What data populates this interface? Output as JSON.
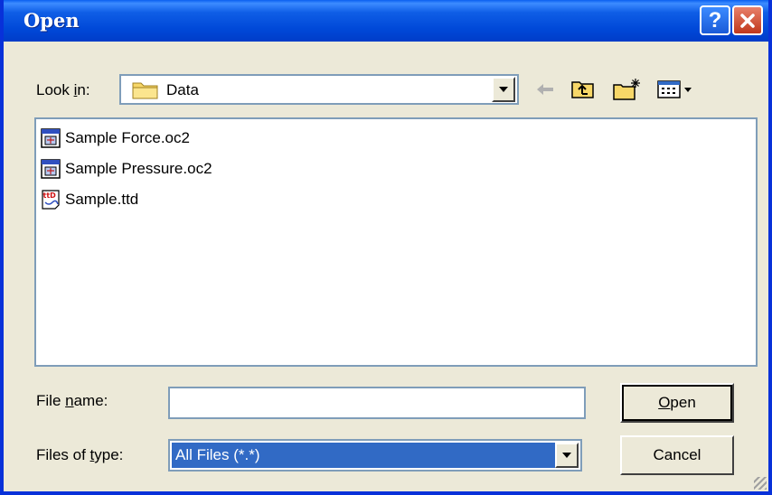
{
  "window": {
    "title": "Open"
  },
  "toolbar": {
    "look_in_label_pre": "Look ",
    "look_in_label_accel": "i",
    "look_in_label_post": "n:",
    "look_in_value": "Data",
    "icons": [
      "back-arrow-icon",
      "up-folder-icon",
      "new-folder-icon",
      "view-menu-icon"
    ]
  },
  "files": [
    {
      "name": "Sample Force.oc2",
      "icon": "oc2-file-icon"
    },
    {
      "name": "Sample Pressure.oc2",
      "icon": "oc2-file-icon"
    },
    {
      "name": "Sample.ttd",
      "icon": "ttd-file-icon"
    }
  ],
  "filename": {
    "label_pre": "File ",
    "label_accel": "n",
    "label_post": "ame:",
    "value": ""
  },
  "filetype": {
    "label_pre": "Files of ",
    "label_accel": "t",
    "label_post": "ype:",
    "value": "All Files (*.*)"
  },
  "buttons": {
    "open_accel": "O",
    "open_rest": "pen",
    "cancel": "Cancel"
  },
  "colors": {
    "titlebar": "#0048d8",
    "face": "#ece9d8",
    "selection": "#316ac5"
  }
}
